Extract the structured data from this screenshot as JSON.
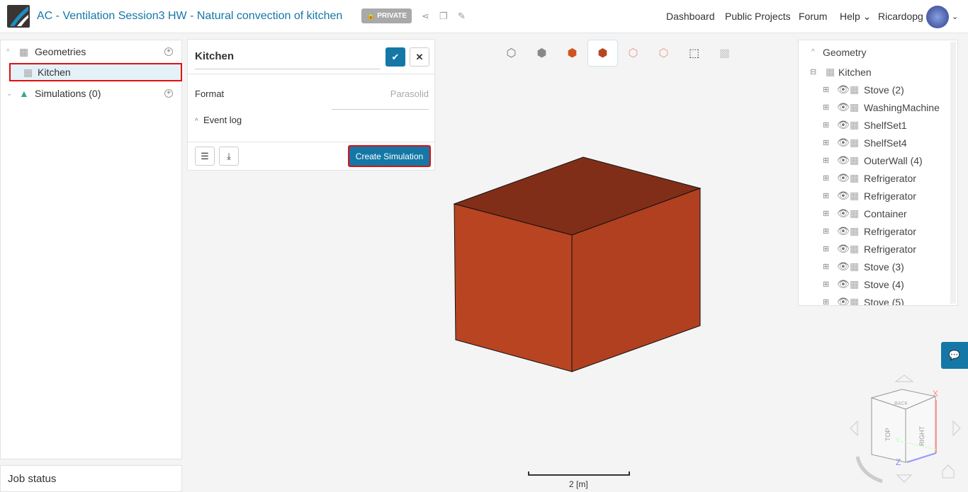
{
  "header": {
    "title": "AC - Ventilation Session3 HW - Natural convection of kitchen",
    "private_badge": "PRIVATE",
    "nav": [
      "Dashboard",
      "Public Projects",
      "Forum",
      "Help"
    ],
    "user": "Ricardopg"
  },
  "left_tree": {
    "geometries": "Geometries",
    "kitchen": "Kitchen",
    "simulations": "Simulations (0)"
  },
  "job_status": "Job status",
  "panel": {
    "name": "Kitchen",
    "format_label": "Format",
    "format_value": "Parasolid",
    "event_log": "Event log",
    "create_button": "Create Simulation"
  },
  "geometry_tree": {
    "title": "Geometry",
    "root": "Kitchen",
    "items": [
      "Stove (2)",
      "WashingMachine",
      "ShelfSet1",
      "ShelfSet4",
      "OuterWall (4)",
      "Refrigerator",
      "Refrigerator",
      "Container",
      "Refrigerator",
      "Refrigerator",
      "Stove (3)",
      "Stove (4)",
      "Stove (5)"
    ]
  },
  "scale_label": "2 [m]",
  "viewcube": {
    "top": "TOP",
    "right": "RIGHT",
    "back": "BACK",
    "x": "X",
    "y": "Y",
    "z": "Z"
  },
  "colors": {
    "accent": "#1577a6",
    "cube_front": "#b84422",
    "cube_right": "#b04020",
    "cube_top": "#812e18"
  }
}
